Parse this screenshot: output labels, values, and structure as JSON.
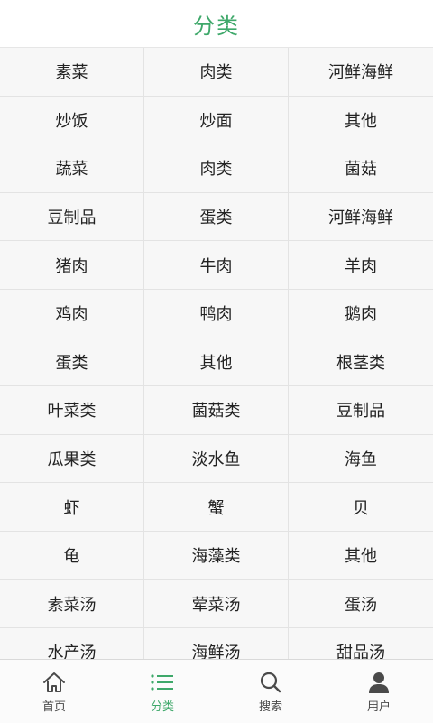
{
  "header": {
    "title": "分类"
  },
  "categories": [
    [
      "素菜",
      "肉类",
      "河鲜海鲜"
    ],
    [
      "炒饭",
      "炒面",
      "其他"
    ],
    [
      "蔬菜",
      "肉类",
      "菌菇"
    ],
    [
      "豆制品",
      "蛋类",
      "河鲜海鲜"
    ],
    [
      "猪肉",
      "牛肉",
      "羊肉"
    ],
    [
      "鸡肉",
      "鸭肉",
      "鹅肉"
    ],
    [
      "蛋类",
      "其他",
      "根茎类"
    ],
    [
      "叶菜类",
      "菌菇类",
      "豆制品"
    ],
    [
      "瓜果类",
      "淡水鱼",
      "海鱼"
    ],
    [
      "虾",
      "蟹",
      "贝"
    ],
    [
      "龟",
      "海藻类",
      "其他"
    ],
    [
      "素菜汤",
      "荤菜汤",
      "蛋汤"
    ],
    [
      "水产汤",
      "海鲜汤",
      "甜品汤"
    ]
  ],
  "tabbar": {
    "accent": "#3ea86a",
    "items": [
      {
        "label": "首页",
        "icon": "home-icon",
        "active": false
      },
      {
        "label": "分类",
        "icon": "list-icon",
        "active": true
      },
      {
        "label": "搜索",
        "icon": "search-icon",
        "active": false
      },
      {
        "label": "用户",
        "icon": "user-icon",
        "active": false
      }
    ]
  }
}
